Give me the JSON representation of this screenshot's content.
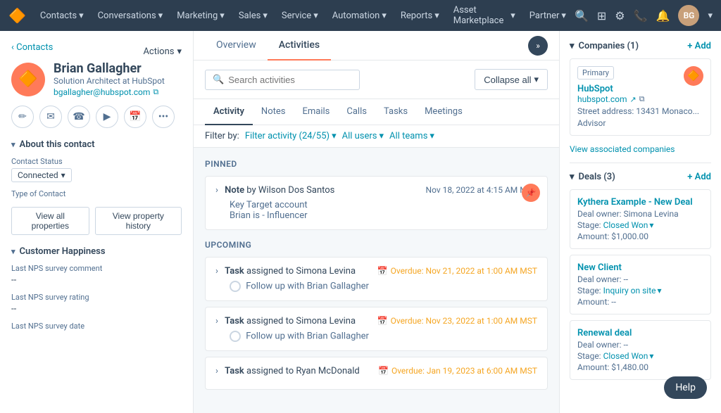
{
  "nav": {
    "logo": "🔶",
    "items": [
      {
        "label": "Contacts",
        "id": "contacts"
      },
      {
        "label": "Conversations",
        "id": "conversations"
      },
      {
        "label": "Marketing",
        "id": "marketing"
      },
      {
        "label": "Sales",
        "id": "sales"
      },
      {
        "label": "Service",
        "id": "service"
      },
      {
        "label": "Automation",
        "id": "automation"
      },
      {
        "label": "Reports",
        "id": "reports"
      },
      {
        "label": "Asset Marketplace",
        "id": "asset-marketplace"
      },
      {
        "label": "Partner",
        "id": "partner"
      }
    ],
    "avatar_initials": "BG"
  },
  "left_panel": {
    "breadcrumb": "Contacts",
    "actions_label": "Actions",
    "contact": {
      "name": "Brian Gallagher",
      "title": "Solution Architect at HubSpot",
      "email": "bgallagher@hubspot.com"
    },
    "action_icons": [
      {
        "name": "edit-icon",
        "symbol": "✏"
      },
      {
        "name": "email-icon",
        "symbol": "✉"
      },
      {
        "name": "phone-icon",
        "symbol": "📞"
      },
      {
        "name": "video-icon",
        "symbol": "🎬"
      },
      {
        "name": "calendar-icon",
        "symbol": "📅"
      },
      {
        "name": "more-icon",
        "symbol": "•••"
      }
    ],
    "about_section": {
      "title": "About this contact",
      "contact_status_label": "Contact Status",
      "contact_status_value": "Connected",
      "type_of_contact_label": "Type of Contact",
      "view_all_properties_btn": "View all properties",
      "view_property_history_btn": "View property history"
    },
    "customer_happiness_section": {
      "title": "Customer Happiness",
      "last_nps_comment_label": "Last NPS survey comment",
      "last_nps_comment_value": "--",
      "last_nps_rating_label": "Last NPS survey rating",
      "last_nps_rating_value": "--",
      "last_nps_date_label": "Last NPS survey date"
    }
  },
  "center_panel": {
    "tabs": [
      {
        "label": "Overview",
        "id": "overview",
        "active": false
      },
      {
        "label": "Activities",
        "id": "activities",
        "active": true
      }
    ],
    "search_placeholder": "Search activities",
    "collapse_btn": "Collapse all",
    "activity_tabs": [
      {
        "label": "Activity",
        "id": "activity",
        "active": true
      },
      {
        "label": "Notes",
        "id": "notes",
        "active": false
      },
      {
        "label": "Emails",
        "id": "emails",
        "active": false
      },
      {
        "label": "Calls",
        "id": "calls",
        "active": false
      },
      {
        "label": "Tasks",
        "id": "tasks",
        "active": false
      },
      {
        "label": "Meetings",
        "id": "meetings",
        "active": false
      }
    ],
    "filter_bar": {
      "filter_by_label": "Filter by:",
      "filter_activity_btn": "Filter activity (24/55)",
      "all_users_btn": "All users",
      "all_teams_btn": "All teams"
    },
    "pinned_section_title": "Pinned",
    "pinned_item": {
      "type": "Note",
      "author": "by Wilson Dos Santos",
      "timestamp": "Nov 18, 2022 at 4:15 AM MST",
      "line1": "Key Target account",
      "line2": "Brian is - Influencer"
    },
    "upcoming_section_title": "Upcoming",
    "upcoming_items": [
      {
        "type": "Task",
        "assignee": "assigned to Simona Levina",
        "overdue": "Overdue: Nov 21, 2022 at 1:00 AM MST",
        "description": "Follow up with Brian Gallagher"
      },
      {
        "type": "Task",
        "assignee": "assigned to Simona Levina",
        "overdue": "Overdue: Nov 23, 2022 at 1:00 AM MST",
        "description": "Follow up with Brian Gallagher"
      },
      {
        "type": "Task",
        "assignee": "assigned to Ryan McDonald",
        "overdue": "Overdue: Jan 19, 2023 at 6:00 AM MST",
        "description": ""
      }
    ]
  },
  "right_panel": {
    "companies_section": {
      "title": "Companies (1)",
      "add_label": "+ Add",
      "primary_badge": "Primary",
      "company": {
        "name": "HubSpot",
        "url": "hubspot.com",
        "address": "Street address: 13431 Monaco...",
        "role": "Advisor"
      },
      "view_associated_companies_label": "View associated companies"
    },
    "deals_section": {
      "title": "Deals (3)",
      "add_label": "+ Add",
      "deals": [
        {
          "name": "Kythera Example - New Deal",
          "owner_label": "Deal owner:",
          "owner": "Simona Levina",
          "stage_label": "Stage:",
          "stage": "Closed Won",
          "amount_label": "Amount:",
          "amount": "$1,000.00"
        },
        {
          "name": "New Client",
          "owner_label": "Deal owner:",
          "owner": "--",
          "stage_label": "Stage:",
          "stage": "Inquiry on site",
          "amount_label": "Amount:",
          "amount": "--"
        },
        {
          "name": "Renewal deal",
          "owner_label": "Deal owner:",
          "owner": "--",
          "stage_label": "Stage:",
          "stage": "Closed Won",
          "amount_label": "Amount:",
          "amount": "$1,480.00"
        }
      ]
    },
    "help_btn": "Help"
  }
}
